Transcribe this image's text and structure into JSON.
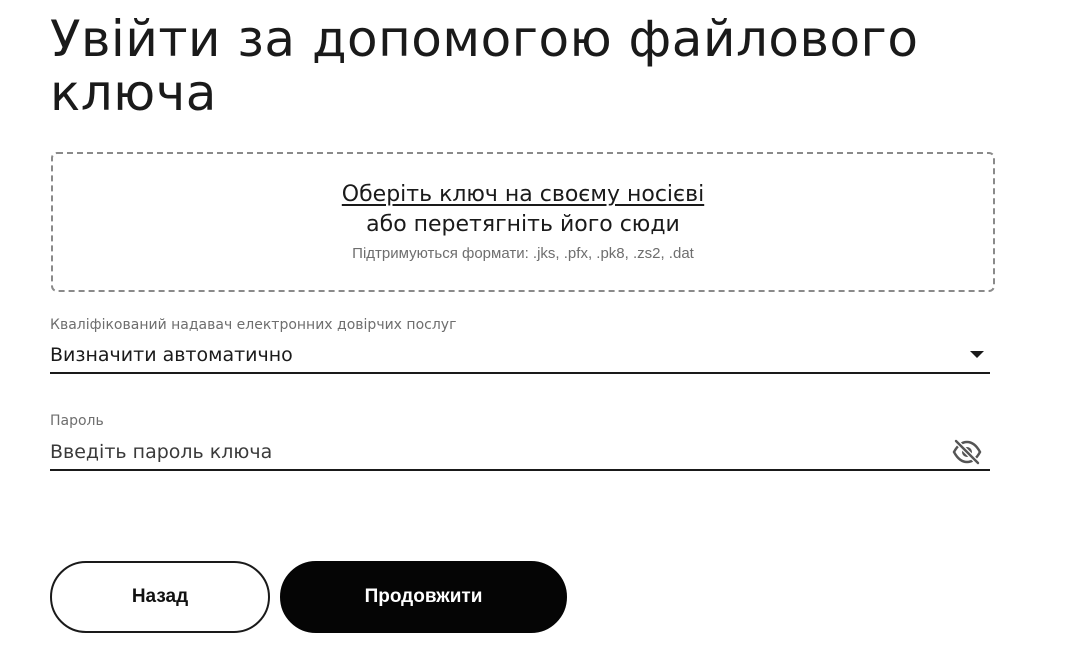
{
  "page": {
    "title": "Увійти за допомогою файлового ключа"
  },
  "dropzone": {
    "link_text": "Оберіть ключ на своєму носієві",
    "drag_text": "або перетягніть його сюди",
    "formats_text": "Підтримуються формати: .jks, .pfx, .pk8, .zs2, .dat",
    "icon": "none"
  },
  "provider": {
    "label": "Кваліфікований надавач електронних довірчих послуг",
    "selected": "Визначити автоматично",
    "icon": "chevron-down-icon"
  },
  "password": {
    "label": "Пароль",
    "value": "",
    "placeholder": "Введіть пароль ключа",
    "icon": "eye-off-icon"
  },
  "actions": {
    "back_label": "Назад",
    "continue_label": "Продовжити"
  },
  "colors": {
    "text": "#1a1a1a",
    "muted": "#6e6e6e",
    "primary_button": "#050505",
    "dropzone_border": "#8a8a8a"
  }
}
